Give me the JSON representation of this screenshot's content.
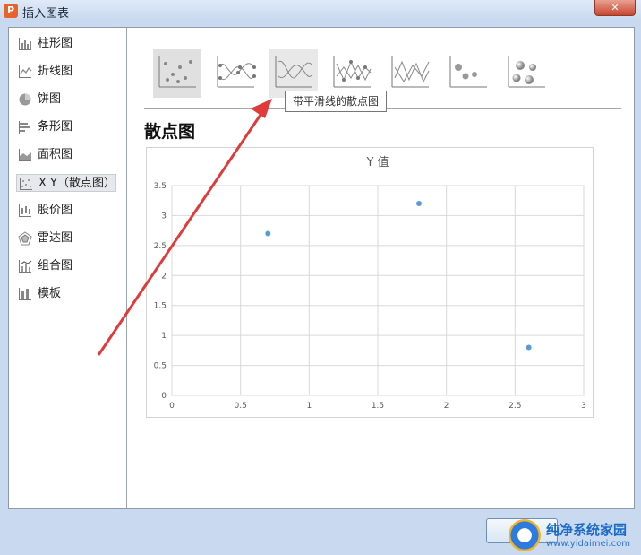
{
  "window": {
    "title": "插入图表",
    "close_label": "✕",
    "logo_letter": "P"
  },
  "sidebar": {
    "items": [
      {
        "label": "柱形图",
        "icon": "column-chart-icon",
        "selected": false
      },
      {
        "label": "折线图",
        "icon": "line-chart-icon",
        "selected": false
      },
      {
        "label": "饼图",
        "icon": "pie-chart-icon",
        "selected": false
      },
      {
        "label": "条形图",
        "icon": "bar-chart-icon",
        "selected": false
      },
      {
        "label": "面积图",
        "icon": "area-chart-icon",
        "selected": false
      },
      {
        "label": "X Y（散点图）",
        "icon": "scatter-chart-icon",
        "selected": true
      },
      {
        "label": "股价图",
        "icon": "stock-chart-icon",
        "selected": false
      },
      {
        "label": "雷达图",
        "icon": "radar-chart-icon",
        "selected": false
      },
      {
        "label": "组合图",
        "icon": "combo-chart-icon",
        "selected": false
      },
      {
        "label": "模板",
        "icon": "template-icon",
        "selected": false
      }
    ]
  },
  "subtypes": {
    "items": [
      {
        "icon": "scatter-markers-icon",
        "state": "selected"
      },
      {
        "icon": "scatter-smooth-lines-markers-icon",
        "state": "normal"
      },
      {
        "icon": "scatter-smooth-lines-icon",
        "state": "hovered"
      },
      {
        "icon": "scatter-straight-lines-markers-icon",
        "state": "normal"
      },
      {
        "icon": "scatter-straight-lines-icon",
        "state": "normal"
      },
      {
        "icon": "bubble-icon",
        "state": "normal"
      },
      {
        "icon": "bubble-3d-icon",
        "state": "normal"
      }
    ],
    "tooltip": "带平滑线的散点图"
  },
  "section_title": "散点图",
  "chart_data": {
    "type": "scatter",
    "title": "Y 值",
    "series": [
      {
        "name": "Y 值",
        "x": [
          0.7,
          1.8,
          2.6
        ],
        "y": [
          2.7,
          3.2,
          0.8
        ]
      }
    ],
    "xlim": [
      0,
      3
    ],
    "ylim": [
      0,
      3.5
    ],
    "xticks": [
      "0",
      "0.5",
      "1",
      "1.5",
      "2",
      "2.5",
      "3"
    ],
    "yticks": [
      "0",
      "0.5",
      "1",
      "1.5",
      "2",
      "2.5",
      "3",
      "3.5"
    ],
    "grid": true,
    "marker_color": "#5b9bd5"
  },
  "annotation": {
    "color": "#e03a3a"
  },
  "watermark": {
    "title": "纯净系统家园",
    "url": "www.yidaimei.com"
  }
}
